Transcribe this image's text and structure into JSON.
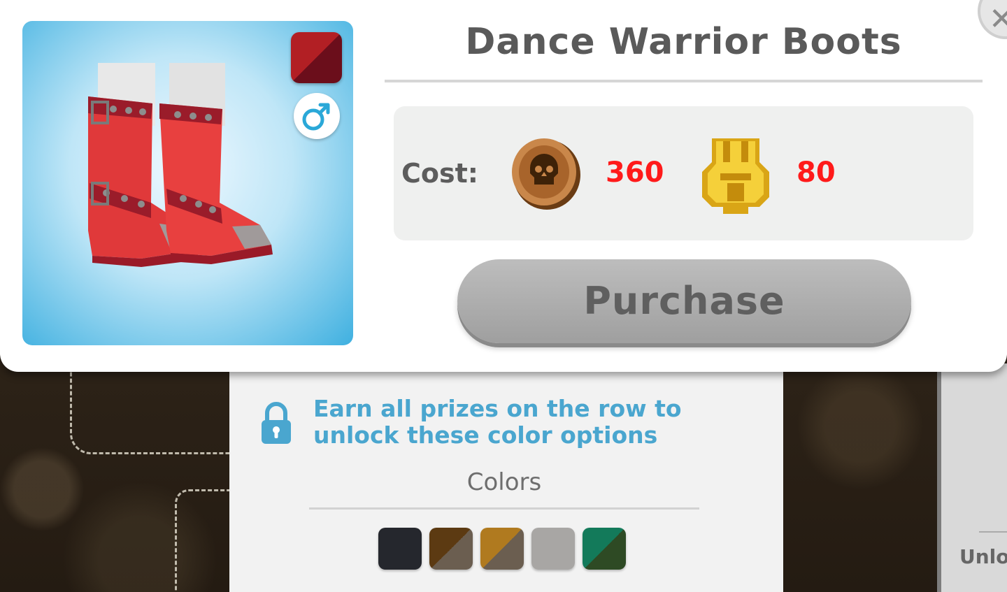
{
  "item": {
    "title": "Dance Warrior Boots",
    "selected_color": [
      "#b21f24",
      "#6b0e1b"
    ],
    "gender_icon": "male-symbol-icon"
  },
  "cost": {
    "label": "Cost:",
    "currencies": [
      {
        "icon": "skull-coin-icon",
        "amount": "360",
        "color": "#ff1a1a"
      },
      {
        "icon": "gold-token-icon",
        "amount": "80",
        "color": "#ff1a1a"
      }
    ]
  },
  "purchase": {
    "label": "Purchase",
    "enabled": false
  },
  "colors_panel": {
    "lock_icon": "lock-icon",
    "unlock_message": "Earn all prizes on the row to unlock these color options",
    "title": "Colors",
    "swatches": [
      {
        "name": "black",
        "colors": [
          "#25272d",
          "#25272d"
        ]
      },
      {
        "name": "brown",
        "colors": [
          "#6b5e50",
          "#5c3a12"
        ]
      },
      {
        "name": "tan",
        "colors": [
          "#6b5e50",
          "#b07a1f"
        ]
      },
      {
        "name": "gray",
        "colors": [
          "#a8a6a4",
          "#a8a6a4"
        ]
      },
      {
        "name": "green",
        "colors": [
          "#2e4a24",
          "#137a5a"
        ]
      }
    ]
  },
  "background": {
    "side_button_text": "Unlo"
  },
  "close": {
    "icon": "close-icon"
  }
}
